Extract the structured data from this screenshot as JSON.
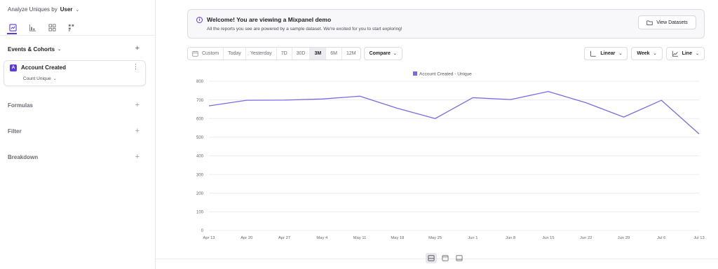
{
  "sidebar": {
    "analyze_label": "Analyze Uniques by",
    "analyze_value": "User",
    "view_tabs": [
      "insights-icon",
      "bar-chart-icon",
      "grid-icon",
      "funnel-icon"
    ],
    "events_title": "Events & Cohorts",
    "event": {
      "badge": "A",
      "name": "Account Created",
      "measure": "Count Unique"
    },
    "formulas_title": "Formulas",
    "filter_title": "Filter",
    "breakdown_title": "Breakdown"
  },
  "banner": {
    "title": "Welcome! You are viewing a Mixpanel demo",
    "subtitle": "All the reports you see are powered by a sample dataset. We're excited for you to start exploring!",
    "button": "View Datasets"
  },
  "toolbar": {
    "custom_label": "Custom",
    "ranges": [
      "Today",
      "Yesterday",
      "7D",
      "30D",
      "3M",
      "6M",
      "12M"
    ],
    "active_range": "3M",
    "compare": "Compare",
    "scale": "Linear",
    "interval": "Week",
    "chart_type": "Line"
  },
  "accent": "#5d3bdb",
  "line_color": "#7b6ae6",
  "chart_data": {
    "type": "line",
    "title": "",
    "xlabel": "",
    "ylabel": "",
    "ylim": [
      0,
      800
    ],
    "yticks": [
      0,
      100,
      200,
      300,
      400,
      500,
      600,
      700,
      800
    ],
    "categories": [
      "Apr 13",
      "Apr 20",
      "Apr 27",
      "May 4",
      "May 11",
      "May 18",
      "May 25",
      "Jun 1",
      "Jun 8",
      "Jun 15",
      "Jun 22",
      "Jun 29",
      "Jul 6",
      "Jul 13"
    ],
    "series": [
      {
        "name": "Account Created - Unique",
        "values": [
          668,
          698,
          699,
          705,
          720,
          655,
          600,
          712,
          702,
          745,
          685,
          608,
          698,
          518
        ]
      }
    ],
    "legend": "top-center",
    "grid": true
  }
}
